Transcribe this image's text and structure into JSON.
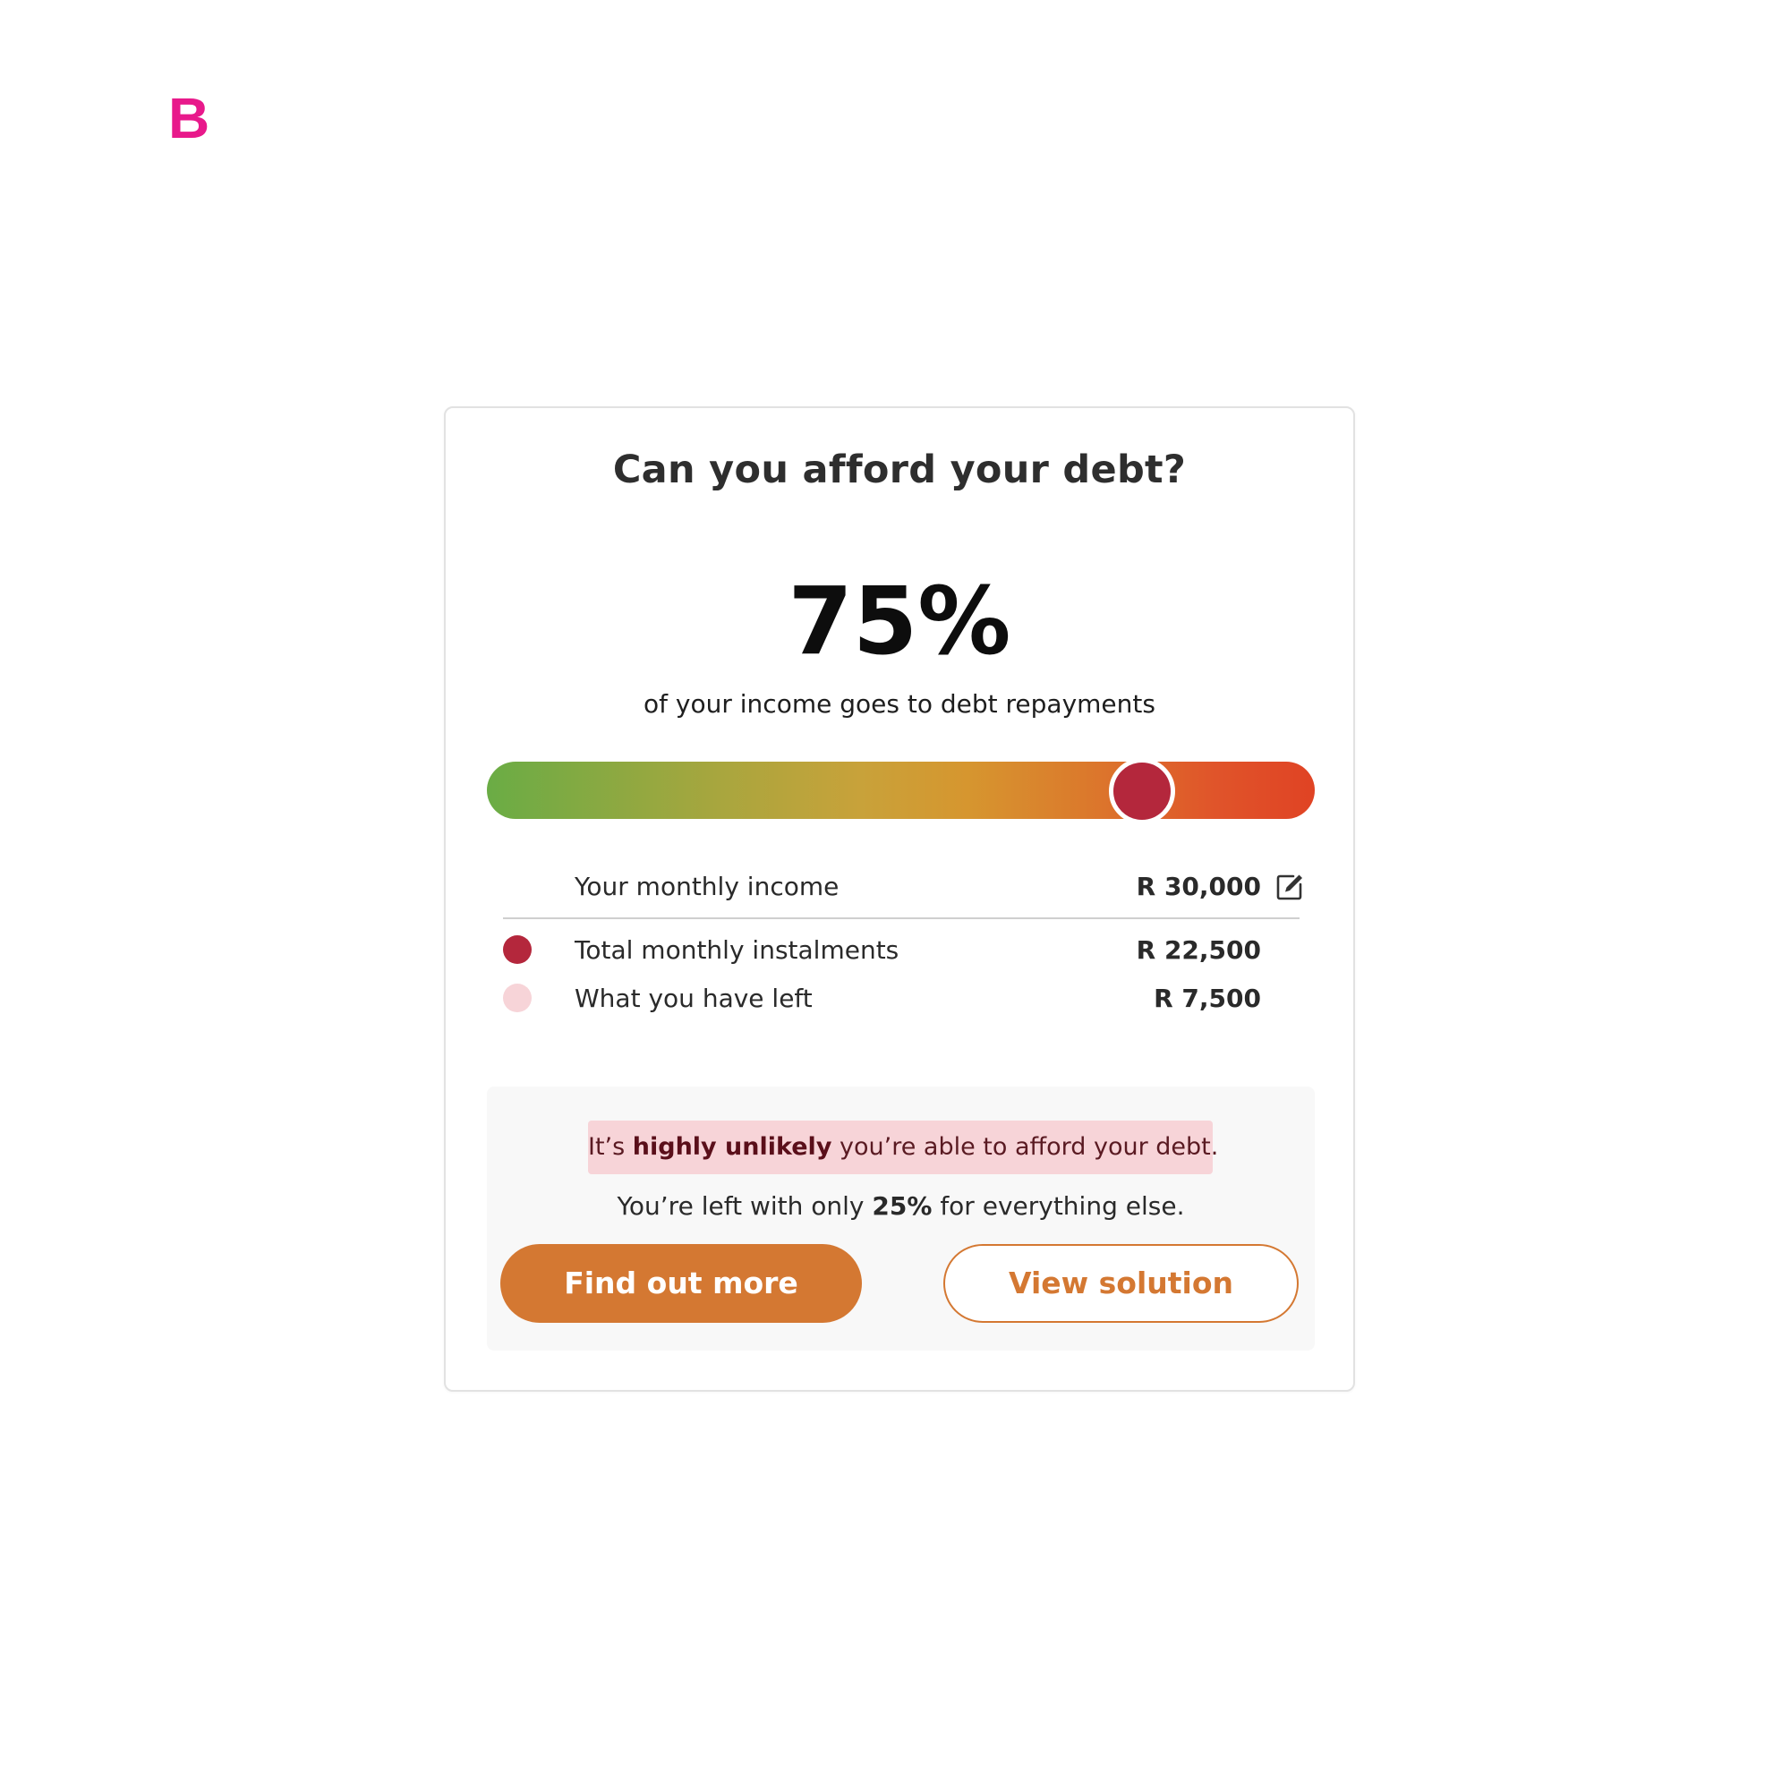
{
  "brand": {
    "logo_text": "B",
    "color": "#e8198b"
  },
  "card": {
    "title": "Can you afford your debt?",
    "percent": "75%",
    "subtitle": "of your income goes to debt repayments",
    "meter": {
      "value_fraction": 0.79,
      "knob_color": "#b4273c"
    },
    "income": {
      "label": "Your monthly income",
      "value": "R 30,000",
      "edit_icon": "pencil-square-icon"
    },
    "rows": [
      {
        "label": "Total monthly instalments",
        "value": "R 22,500",
        "dot_color": "#b4273c"
      },
      {
        "label": "What you have left",
        "value": "R 7,500",
        "dot_color": "#f7d4d8"
      }
    ],
    "verdict": {
      "prefix": "It’s ",
      "emphasis": "highly unlikely",
      "suffix": " you’re able to afford your debt."
    },
    "leftover": {
      "prefix": "You’re left with only ",
      "emphasis": "25%",
      "suffix": " for everything else."
    },
    "buttons": {
      "primary": "Find out more",
      "secondary": "View solution"
    },
    "accent_color": "#d47832"
  }
}
